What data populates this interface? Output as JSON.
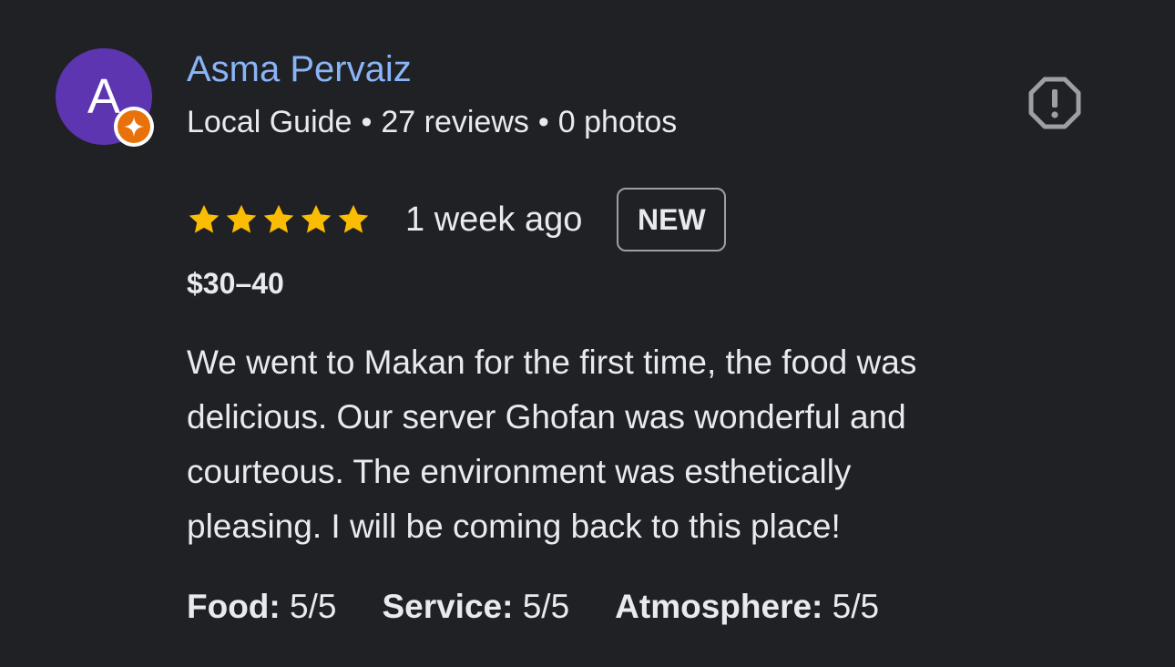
{
  "author": {
    "initial": "A",
    "name": "Asma Pervaiz",
    "meta": [
      "Local Guide",
      "27 reviews",
      "0 photos"
    ],
    "badge_icon": "local-guide-star-icon",
    "avatar_color": "#5e35b1"
  },
  "report": {
    "icon": "report-icon"
  },
  "review": {
    "rating": 5,
    "max_rating": 5,
    "star_color": "#fbbc04",
    "time_ago": "1 week ago",
    "badge": "NEW",
    "price": "$30–40",
    "text_lines": [
      "We went to Makan for the first time, the food was",
      "delicious. Our server Ghofan was wonderful and",
      "courteous. The environment was esthetically",
      "pleasing. I will be coming back to this place!"
    ],
    "sub_ratings": [
      {
        "label": "Food:",
        "value": "5/5"
      },
      {
        "label": "Service:",
        "value": "5/5"
      },
      {
        "label": "Atmosphere:",
        "value": "5/5"
      }
    ]
  },
  "colors": {
    "background": "#202124",
    "name_link": "#8ab4f8",
    "text": "#e8eaed",
    "badge_orange": "#e8710a"
  }
}
